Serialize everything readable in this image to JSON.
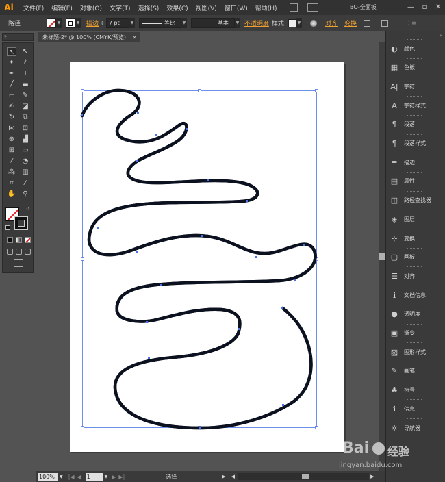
{
  "app": {
    "logo": "Ai",
    "workspace": "BO-全面板",
    "min": "—",
    "max": "▫",
    "close": "✕"
  },
  "menu": [
    "文件(F)",
    "编辑(E)",
    "对象(O)",
    "文字(T)",
    "选择(S)",
    "效果(C)",
    "视图(V)",
    "窗口(W)",
    "帮助(H)"
  ],
  "control": {
    "mode": "路径",
    "stroke_label": "描边",
    "stroke_weight": "7 pt",
    "profile": "等比",
    "brush": "基本",
    "opacity": "不透明度",
    "style": "样式:",
    "align": "对齐",
    "transform": "变换"
  },
  "document": {
    "tab_title": "未标题-2* @ 100% (CMYK/预览)",
    "tab_close": "×"
  },
  "status": {
    "zoom": "100%",
    "page": "1",
    "tool": "选择"
  },
  "panels": [
    "颜色",
    "色板",
    "字符",
    "字符样式",
    "段落",
    "段落样式",
    "描边",
    "属性",
    "路径查找器",
    "图层",
    "变换",
    "画板",
    "对齐",
    "文档信息",
    "透明度",
    "渐变",
    "图形样式",
    "画笔",
    "符号",
    "信息",
    "导航器"
  ],
  "panel_icons": [
    "palette-icon",
    "swatches-icon",
    "character-icon",
    "character-style-icon",
    "paragraph-icon",
    "paragraph-style-icon",
    "stroke-icon",
    "attributes-icon",
    "pathfinder-icon",
    "layers-icon",
    "transform-icon",
    "artboard-icon",
    "align-icon",
    "document-info-icon",
    "transparency-icon",
    "gradient-icon",
    "graphic-styles-icon",
    "brush-icon",
    "symbols-icon",
    "info-icon",
    "navigator-icon"
  ],
  "watermark": {
    "brand": "Bai",
    "brand2": "经验",
    "url": "jingyan.baidu.com"
  },
  "colors": {
    "path": "#0c1120",
    "selection": "#4a72e8",
    "accent": "#ff9a00"
  }
}
